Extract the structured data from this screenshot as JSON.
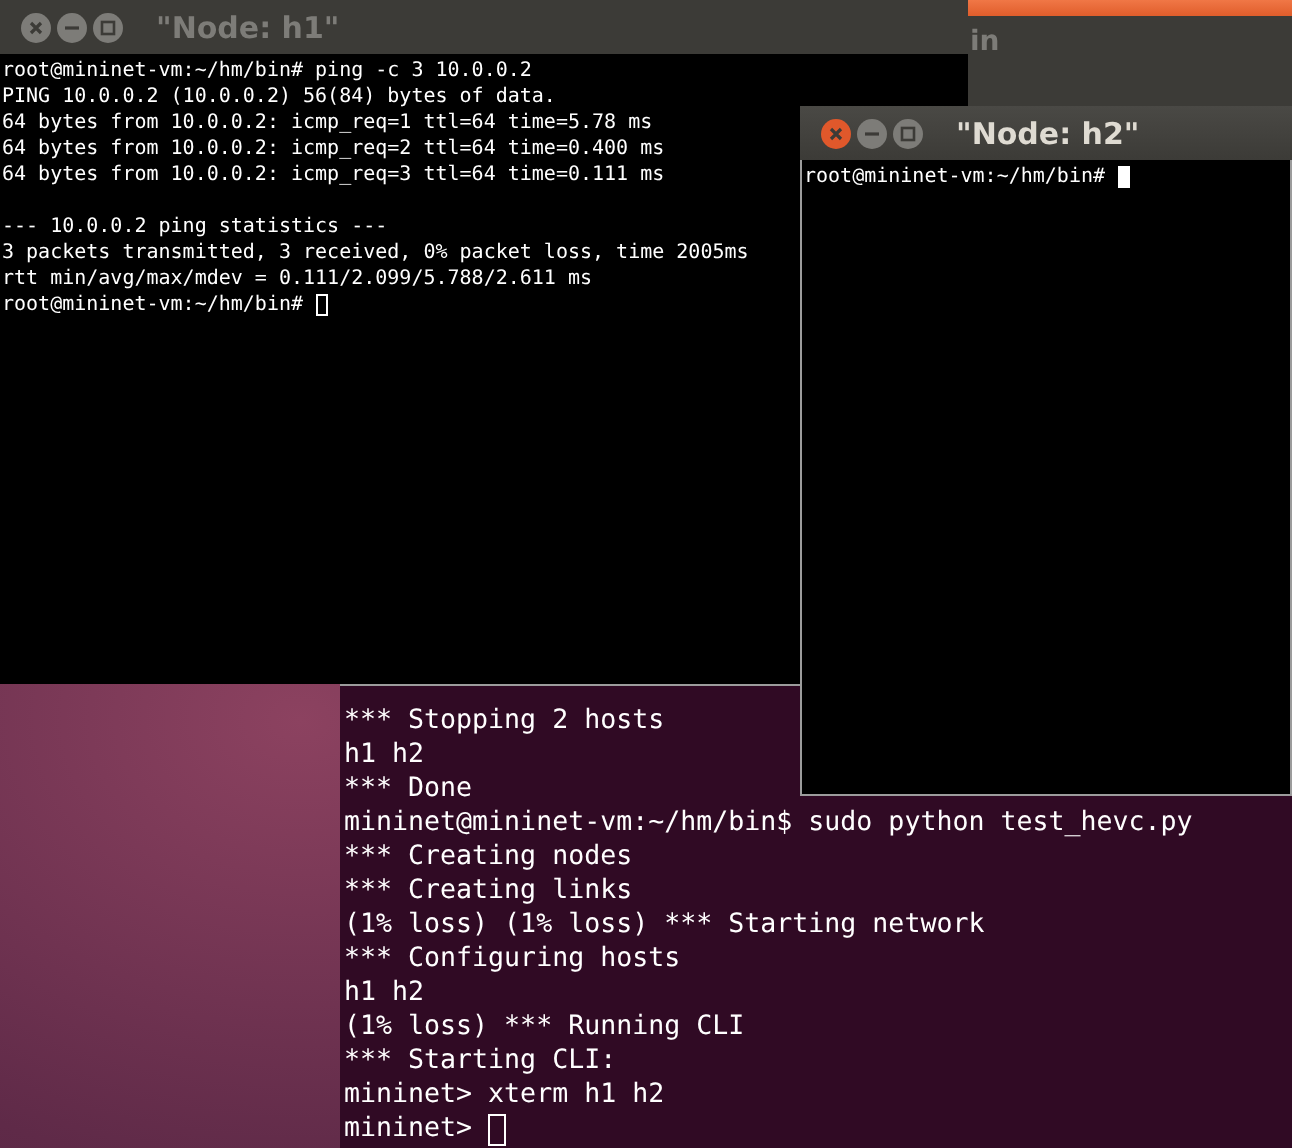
{
  "background_window": {
    "title_fragment": "in"
  },
  "windows": [
    {
      "kind": "xterm",
      "title": "\"Node: h1\"",
      "focused": false,
      "blocks": [
        [
          "root@mininet-vm:~/hm/bin# ping -c 3 10.0.0.2",
          "PING 10.0.0.2 (10.0.0.2) 56(84) bytes of data.",
          "64 bytes from 10.0.0.2: icmp_req=1 ttl=64 time=5.78 ms",
          "64 bytes from 10.0.0.2: icmp_req=2 ttl=64 time=0.400 ms",
          "64 bytes from 10.0.0.2: icmp_req=3 ttl=64 time=0.111 ms"
        ],
        [
          "--- 10.0.0.2 ping statistics ---",
          "3 packets transmitted, 3 received, 0% packet loss, time 2005ms",
          "rtt min/avg/max/mdev = 0.111/2.099/5.788/2.611 ms",
          "root@mininet-vm:~/hm/bin# "
        ]
      ]
    },
    {
      "kind": "xterm",
      "title": "\"Node: h2\"",
      "focused": true,
      "blocks": [
        [
          "root@mininet-vm:~/hm/bin# "
        ]
      ]
    },
    {
      "kind": "gnome",
      "focused": false,
      "blocks": [
        [
          "*** Stopping 2 hosts",
          "h1 h2",
          "*** Done",
          "mininet@mininet-vm:~/hm/bin$ sudo python test_hevc.py",
          "*** Creating nodes",
          "*** Creating links",
          "(1% loss) (1% loss) *** Starting network",
          "*** Configuring hosts",
          "h1 h2",
          "(1% loss) *** Running CLI",
          "*** Starting CLI:",
          "mininet> xterm h1 h2",
          "mininet> "
        ]
      ]
    }
  ]
}
